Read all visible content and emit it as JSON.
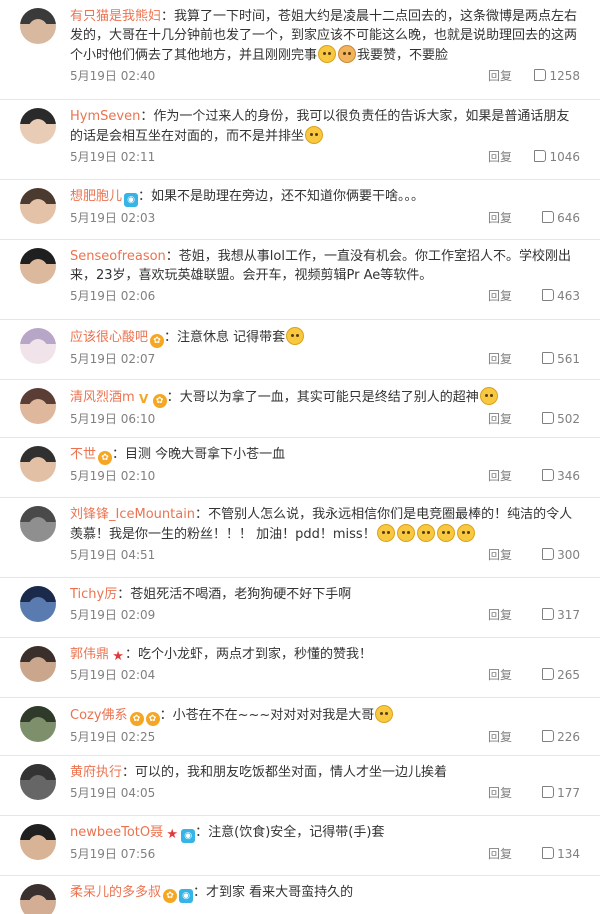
{
  "reply_label": "回复",
  "comments": [
    {
      "name": "有只猫是我熊妇",
      "sep": "：",
      "text_a": "我算了一下时间，苍姐大约是凌晨十二点回去的，这条微博是两点左右发的，大哥在十几分钟前也发了一个，到家应该不可能这么晚，也就是说助理回去的这两个小时他们俩去了其他地方，并且刚刚完事",
      "text_b": "我要赞，不要脸",
      "time": "5月19日 02:40",
      "likes": "1258",
      "avatar_colors": [
        "#3a3a3a",
        "#d9b8a0"
      ]
    },
    {
      "name": "HymSeven",
      "sep": "：",
      "text_a": "作为一个过来人的身份，我可以很负责任的告诉大家，如果是普通话朋友的话是会相互坐在对面的，而不是并排坐",
      "text_b": "",
      "time": "5月19日 02:11",
      "likes": "1046",
      "avatar_colors": [
        "#2a2a2a",
        "#e8ccb6"
      ]
    },
    {
      "name": "想肥胞儿",
      "sep": "：",
      "text_a": "如果不是助理在旁边，还不知道你俩要干啥。。。",
      "text_b": "",
      "time": "5月19日 02:03",
      "likes": "646",
      "avatar_colors": [
        "#4b3a30",
        "#e4c2a8"
      ]
    },
    {
      "name": "Senseofreason",
      "sep": "：",
      "text_a": "苍姐，我想从事lol工作，一直没有机会。你工作室招人不。学校刚出来，23岁，喜欢玩英雄联盟。会开车，视频剪辑Pr  Ae等软件。",
      "text_b": "",
      "time": "5月19日 02:06",
      "likes": "463",
      "avatar_colors": [
        "#1f1f1f",
        "#dcb89c"
      ]
    },
    {
      "name": "应该很心酸吧",
      "sep": "：",
      "text_a": "注意休息 记得带套",
      "text_b": "",
      "time": "5月19日 02:07",
      "likes": "561",
      "avatar_colors": [
        "#b8a6c9",
        "#f1e3ea"
      ]
    },
    {
      "name": "清风烈酒m",
      "sep": "：",
      "text_a": "大哥以为拿了一血，其实可能只是终结了别人的超神",
      "text_b": "",
      "time": "5月19日 06:10",
      "likes": "502",
      "avatar_colors": [
        "#5a3e36",
        "#dfb79c"
      ]
    },
    {
      "name": "不世",
      "sep": "：",
      "text_a": "目测 今晚大哥拿下小苍一血",
      "text_b": "",
      "time": "5月19日 02:10",
      "likes": "346",
      "avatar_colors": [
        "#303030",
        "#e2c0a6"
      ]
    },
    {
      "name": "刘锋锋_IceMountain",
      "sep": "：",
      "text_a": "不管别人怎么说，我永远相信你们是电竞圈最棒的！纯洁的令人羡慕！我是你一生的粉丝！！！        加油！pdd！miss！",
      "text_b": "",
      "time": "5月19日 04:51",
      "likes": "300",
      "avatar_colors": [
        "#4a4a4a",
        "#8f8f8f"
      ]
    },
    {
      "name": "Tichy厉",
      "sep": "：",
      "text_a": "苍姐死活不喝酒，老狗狗硬不好下手啊",
      "text_b": "",
      "time": "5月19日 02:09",
      "likes": "317",
      "avatar_colors": [
        "#1b2a4a",
        "#5a7bb0"
      ]
    },
    {
      "name": "郭伟鼎",
      "sep": "：",
      "text_a": "吃个小龙虾，两点才到家，秒懂的赞我！",
      "text_b": "",
      "time": "5月19日 02:04",
      "likes": "265",
      "avatar_colors": [
        "#3a2f2a",
        "#c9a68c"
      ]
    },
    {
      "name": "Cozy佛系",
      "sep": "：",
      "text_a": "小苍在不在~~~对对对对我是大哥",
      "text_b": "",
      "time": "5月19日 02:25",
      "likes": "226",
      "avatar_colors": [
        "#2f3a2a",
        "#7d8f6b"
      ]
    },
    {
      "name": "黄府执行",
      "sep": "：",
      "text_a": "可以的，我和朋友吃饭都坐对面，情人才坐一边儿挨着",
      "text_b": "",
      "time": "5月19日 04:05",
      "likes": "177",
      "avatar_colors": [
        "#333333",
        "#666666"
      ]
    },
    {
      "name": "newbeeTotO聂",
      "sep": "：",
      "text_a": "注意(饮食)安全，记得带(手)套",
      "text_b": "",
      "time": "5月19日 07:56",
      "likes": "134",
      "avatar_colors": [
        "#202020",
        "#d8b396"
      ]
    },
    {
      "name": "柔呆儿的多多叔",
      "sep": "：",
      "text_a": "才到家  看来大哥蛮持久的",
      "text_b": "",
      "time": "",
      "likes": "",
      "avatar_colors": [
        "#3a3030",
        "#d3ae94"
      ]
    }
  ]
}
